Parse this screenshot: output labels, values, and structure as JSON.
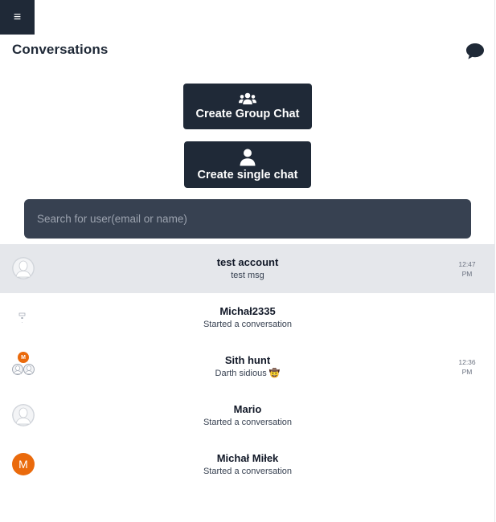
{
  "header": {
    "menu_icon": "hamburger-icon",
    "menu_glyph": "≡",
    "title": "Conversations",
    "new_chat_icon": "chat-bubble-icon"
  },
  "actions": {
    "group_label": "Create Group Chat",
    "group_icon": "users-icon",
    "single_label": "Create single chat",
    "single_icon": "user-icon"
  },
  "search": {
    "placeholder": "Search for user(email or name)",
    "value": ""
  },
  "conversations": [
    {
      "name": "test account",
      "last_message": "test msg",
      "time": "12:47 PM",
      "avatar": "default-avatar",
      "active": true
    },
    {
      "name": "Michał2335",
      "last_message": "Started a conversation",
      "time": "",
      "avatar": "broken-image"
    },
    {
      "name": "Sith hunt",
      "last_message": "Darth sidious 🤠",
      "time": "12:36 PM",
      "avatar": "group-avatar",
      "badge": "M"
    },
    {
      "name": "Mario",
      "last_message": "Started a conversation",
      "time": "",
      "avatar": "default-avatar"
    },
    {
      "name": "Michał Miłek",
      "last_message": "Started a conversation",
      "time": "",
      "avatar": "letter-avatar",
      "letter": "M"
    }
  ],
  "colors": {
    "dark": "#1f2937",
    "search_bg": "#374151",
    "active_row": "#e5e7eb",
    "accent_orange": "#ea6a0c"
  }
}
